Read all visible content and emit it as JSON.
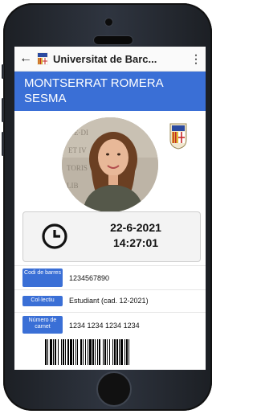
{
  "app_bar": {
    "back_icon": "arrow-back-icon",
    "title": "Universitat de Barc...",
    "menu_icon": "more-vert-icon"
  },
  "card": {
    "holder_name": "MONTSERRAT ROMERA SESMA",
    "date": "22-6-2021",
    "time": "14:27:01",
    "fields": [
      {
        "label": "Codi de barres",
        "value": "1234567890"
      },
      {
        "label": "Col·lectiu",
        "value": "Estudiant (cad. 12-2021)"
      },
      {
        "label": "Número de carnet",
        "value": "1234 1234 1234 1234"
      }
    ]
  },
  "colors": {
    "accent": "#3a6fd6"
  }
}
